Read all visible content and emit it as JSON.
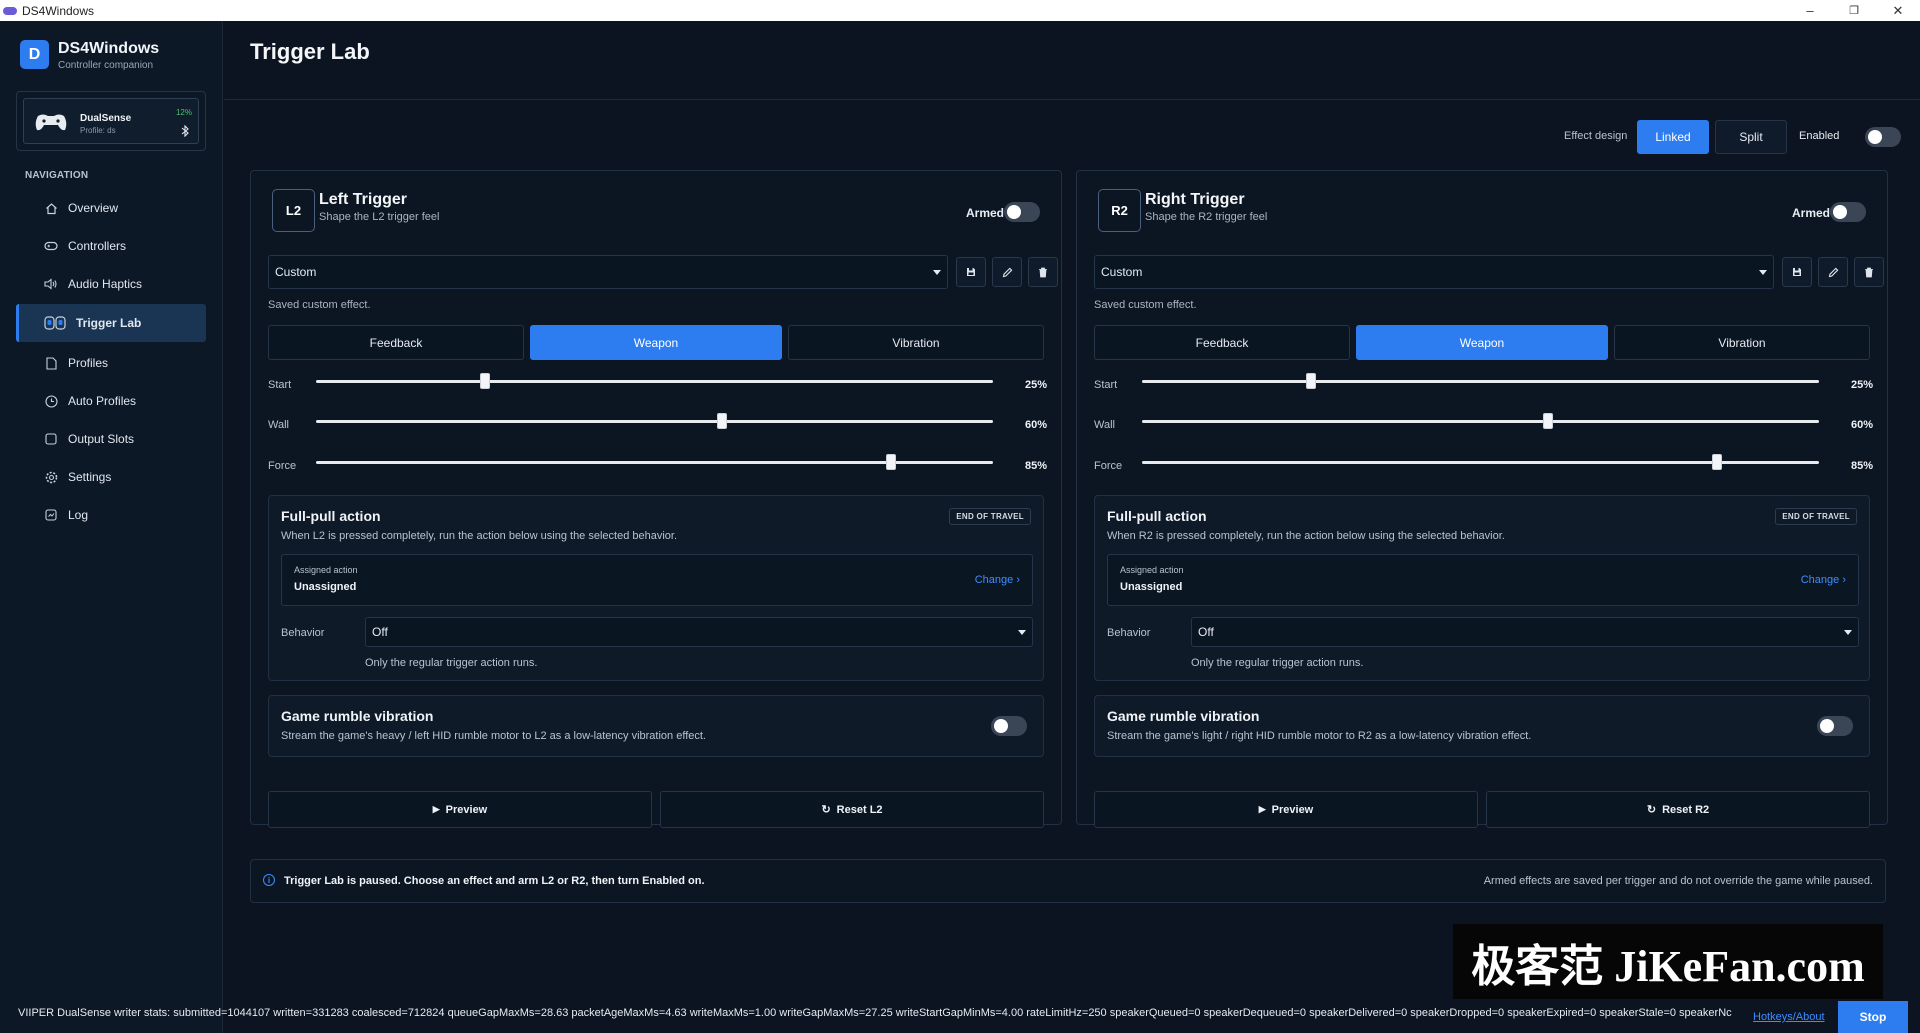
{
  "window": {
    "title": "DS4Windows",
    "minimize": "–",
    "restore": "❐",
    "close": "✕"
  },
  "app": {
    "logo_letter": "D",
    "name": "DS4Windows",
    "subtitle": "Controller companion"
  },
  "controller": {
    "name": "DualSense",
    "profile": "Profile: ds",
    "battery": "12%"
  },
  "nav": {
    "header": "NAVIGATION",
    "items": [
      {
        "label": "Overview",
        "icon": "home-icon"
      },
      {
        "label": "Controllers",
        "icon": "gamepad-icon"
      },
      {
        "label": "Audio Haptics",
        "icon": "speaker-icon"
      },
      {
        "label": "Trigger Lab",
        "icon": "trigger-icon",
        "active": true
      },
      {
        "label": "Profiles",
        "icon": "document-icon"
      },
      {
        "label": "Auto Profiles",
        "icon": "clock-icon"
      },
      {
        "label": "Output Slots",
        "icon": "slot-icon"
      },
      {
        "label": "Settings",
        "icon": "gear-icon"
      },
      {
        "label": "Log",
        "icon": "log-icon"
      }
    ]
  },
  "page": {
    "title": "Trigger Lab"
  },
  "topbar": {
    "effect_design_label": "Effect design",
    "linked": "Linked",
    "split": "Split",
    "enabled_label": "Enabled",
    "enabled": false
  },
  "left": {
    "badge": "L2",
    "title": "Left Trigger",
    "subtitle": "Shape the L2 trigger feel",
    "armed_label": "Armed",
    "armed": false,
    "preset": "Custom",
    "saved_text": "Saved custom effect.",
    "tabs": [
      "Feedback",
      "Weapon",
      "Vibration"
    ],
    "active_tab": "Weapon",
    "sliders": [
      {
        "label": "Start",
        "value": 25,
        "display": "25%"
      },
      {
        "label": "Wall",
        "value": 60,
        "display": "60%"
      },
      {
        "label": "Force",
        "value": 85,
        "display": "85%"
      }
    ],
    "fullpull": {
      "title": "Full-pull action",
      "badge": "END OF TRAVEL",
      "desc": "When L2 is pressed completely, run the action below using the selected behavior.",
      "assigned_label": "Assigned action",
      "assigned_value": "Unassigned",
      "change": "Change ›",
      "behavior_label": "Behavior",
      "behavior_value": "Off",
      "behavior_note": "Only the regular trigger action runs."
    },
    "rumble": {
      "title": "Game rumble vibration",
      "desc": "Stream the game's heavy / left HID rumble motor to L2 as a low-latency vibration effect.",
      "enabled": false
    },
    "preview": "Preview",
    "reset": "Reset L2"
  },
  "right": {
    "badge": "R2",
    "title": "Right Trigger",
    "subtitle": "Shape the R2 trigger feel",
    "armed_label": "Armed",
    "armed": false,
    "preset": "Custom",
    "saved_text": "Saved custom effect.",
    "tabs": [
      "Feedback",
      "Weapon",
      "Vibration"
    ],
    "active_tab": "Weapon",
    "sliders": [
      {
        "label": "Start",
        "value": 25,
        "display": "25%"
      },
      {
        "label": "Wall",
        "value": 60,
        "display": "60%"
      },
      {
        "label": "Force",
        "value": 85,
        "display": "85%"
      }
    ],
    "fullpull": {
      "title": "Full-pull action",
      "badge": "END OF TRAVEL",
      "desc": "When R2 is pressed completely, run the action below using the selected behavior.",
      "assigned_label": "Assigned action",
      "assigned_value": "Unassigned",
      "change": "Change ›",
      "behavior_label": "Behavior",
      "behavior_value": "Off",
      "behavior_note": "Only the regular trigger action runs."
    },
    "rumble": {
      "title": "Game rumble vibration",
      "desc": "Stream the game's light / right HID rumble motor to R2 as a low-latency vibration effect.",
      "enabled": false
    },
    "preview": "Preview",
    "reset": "Reset R2"
  },
  "info": {
    "icon_glyph": "i",
    "message": "Trigger Lab is paused. Choose an effect and arm L2 or R2, then turn Enabled on.",
    "right": "Armed effects are saved per trigger and do not override the game while paused."
  },
  "status": {
    "stats": "VIIPER DualSense writer stats: submitted=1044107 written=331283 coalesced=712824 queueGapMaxMs=28.63 packetAgeMaxMs=4.63 writeMaxMs=1.00 writeGapMaxMs=27.25 writeStartGapMinMs=4.00 rateLimitHz=250 speakerQueued=0 speakerDequeued=0 speakerDelivered=0 speakerDropped=0 speakerExpired=0 speakerStale=0 speakerNc",
    "hotkeys": "Hotkeys/About",
    "stop": "Stop"
  },
  "watermark": "极客范 JiKeFan.com",
  "colors": {
    "accent": "#2d7df0",
    "background": "#0b1420",
    "link": "#3d8dff",
    "battery": "#49c46a"
  }
}
